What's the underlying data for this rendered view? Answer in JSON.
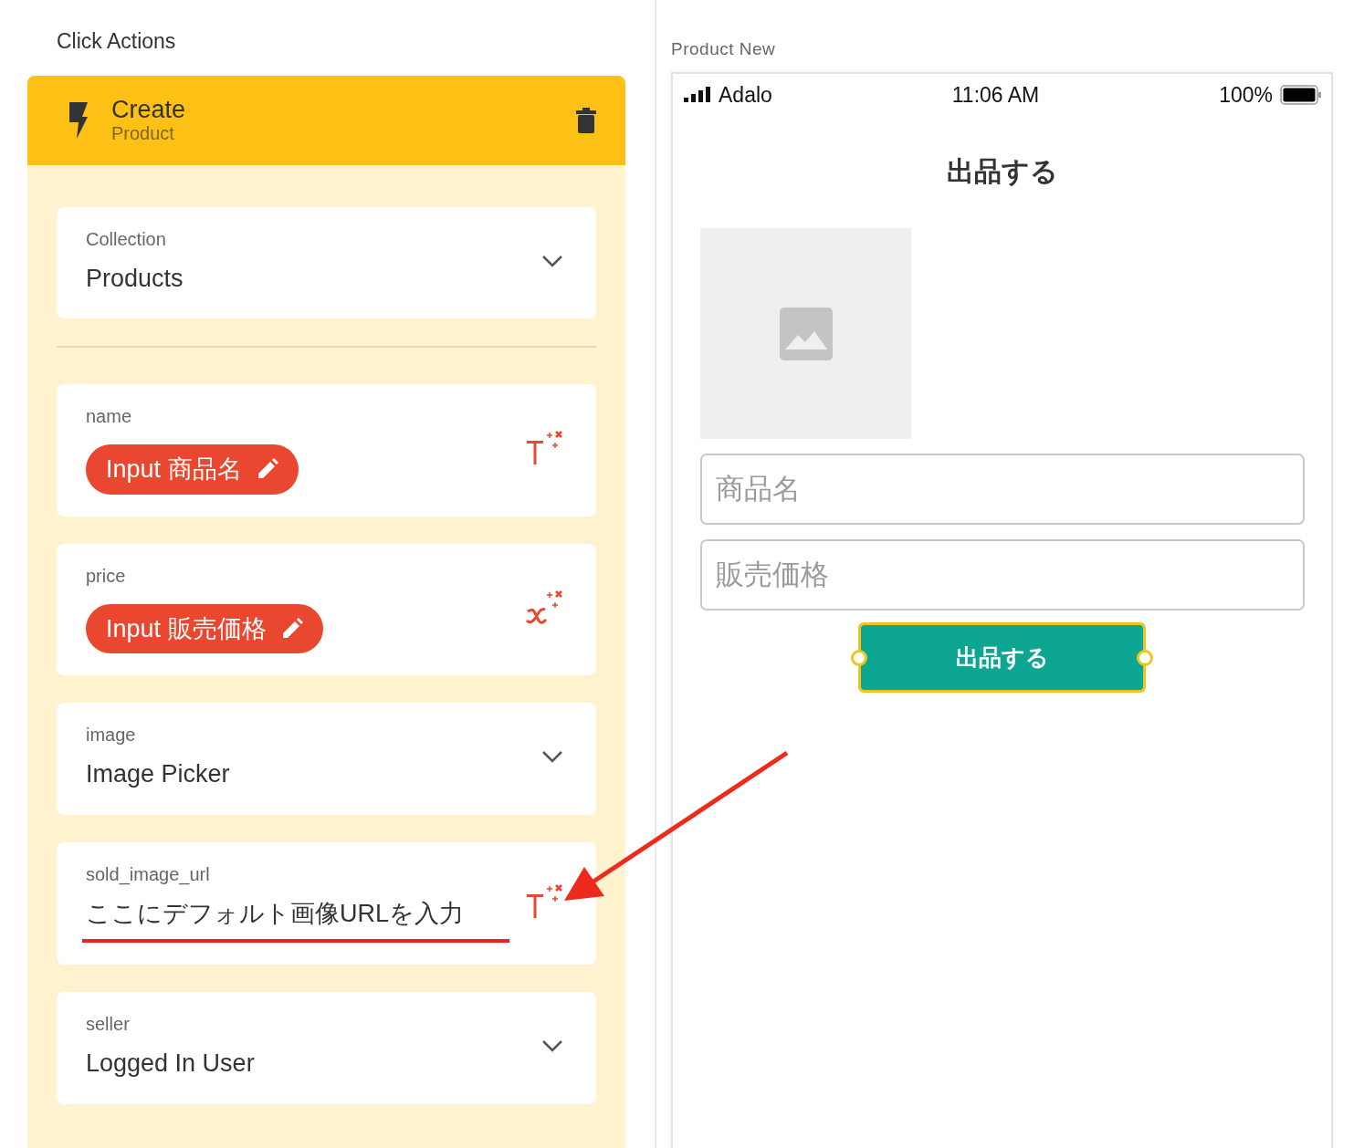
{
  "left_panel": {
    "title": "Click Actions",
    "action": {
      "title": "Create",
      "subtitle": "Product"
    },
    "fields": [
      {
        "kind": "dropdown",
        "label": "Collection",
        "value": "Products",
        "underlined": false
      },
      {
        "kind": "divider"
      },
      {
        "kind": "text",
        "label": "name",
        "chip": "Input 商品名",
        "underlined": false
      },
      {
        "kind": "number",
        "label": "price",
        "chip": "Input 販売価格",
        "underlined": false
      },
      {
        "kind": "dropdown",
        "label": "image",
        "value": "Image Picker",
        "underlined": false
      },
      {
        "kind": "text",
        "label": "sold_image_url",
        "value": "ここにデフォルト画像URLを入力",
        "underlined": true
      },
      {
        "kind": "dropdown",
        "label": "seller",
        "value": "Logged In User",
        "underlined": false
      }
    ]
  },
  "preview": {
    "screen_name": "Product New",
    "status_bar": {
      "carrier": "Adalo",
      "time": "11:06 AM",
      "battery": "100%"
    },
    "title": "出品する",
    "inputs": [
      {
        "placeholder": "商品名"
      },
      {
        "placeholder": "販売価格"
      }
    ],
    "button": {
      "label": "出品する",
      "selected": true
    }
  }
}
